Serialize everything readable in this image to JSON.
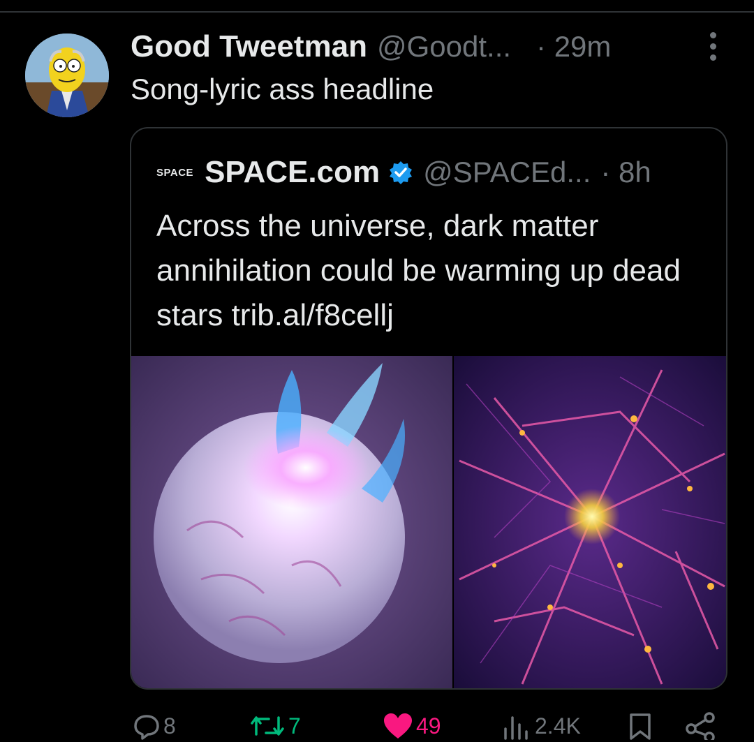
{
  "tweet": {
    "display_name": "Good Tweetman",
    "handle": "@Goodt...",
    "time": "· 29m",
    "text": "Song-lyric ass headline"
  },
  "quote": {
    "logo_text": "SPACE",
    "display_name": "SPACE.com",
    "handle": "@SPACEd...",
    "time": "· 8h",
    "text": "Across the universe, dark matter annihilation could be warming up dead stars trib.al/f8cellj",
    "verified": true
  },
  "actions": {
    "replies": "8",
    "retweets": "7",
    "likes": "49",
    "views": "2.4K"
  },
  "colors": {
    "accent_blue": "#1d9bf0",
    "retweet_green": "#00ba7c",
    "like_pink": "#f91880",
    "muted": "#71767b"
  },
  "icons": [
    "more-icon",
    "verified-badge-icon",
    "reply-icon",
    "retweet-icon",
    "like-icon",
    "views-icon",
    "bookmark-icon",
    "share-icon"
  ]
}
